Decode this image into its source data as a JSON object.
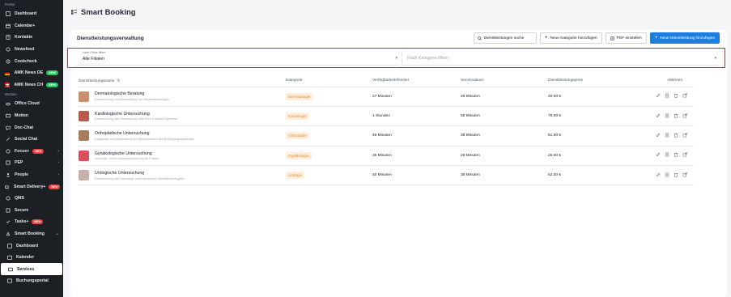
{
  "sidebar": {
    "section_portal": "Portal",
    "section_module": "Module",
    "portal_items": [
      {
        "label": "Dashboard",
        "icon": "dashboard-icon"
      },
      {
        "label": "Calendar+",
        "icon": "calendar-icon"
      },
      {
        "label": "Kontakte",
        "icon": "contacts-icon"
      },
      {
        "label": "Newsfeed",
        "icon": "newsfeed-icon"
      },
      {
        "label": "Cookcheck",
        "icon": "cookcheck-icon"
      },
      {
        "label": "AMK News DE",
        "icon": "flag-de-icon",
        "badge": "NEW"
      },
      {
        "label": "AMK News CH",
        "icon": "flag-ch-icon",
        "badge": "NEW"
      }
    ],
    "module_items": [
      {
        "label": "Office Cloud",
        "icon": "cloud-icon"
      },
      {
        "label": "Motion",
        "icon": "motion-icon"
      },
      {
        "label": "Doc-Chat",
        "icon": "chat-icon"
      },
      {
        "label": "Social Chat",
        "icon": "social-chat-icon"
      },
      {
        "label": "Focus+",
        "icon": "focus-icon",
        "badge": "NEU"
      },
      {
        "label": "PEP",
        "icon": "pep-icon"
      },
      {
        "label": "People",
        "icon": "people-icon"
      },
      {
        "label": "Smart Delivery+",
        "icon": "delivery-icon",
        "badge": "NEU"
      },
      {
        "label": "QMS",
        "icon": "qms-icon"
      },
      {
        "label": "Secure",
        "icon": "secure-icon"
      },
      {
        "label": "Tasks+",
        "icon": "tasks-icon",
        "badge": "NEU"
      },
      {
        "label": "Smart Booking",
        "icon": "booking-icon"
      }
    ],
    "sub_items": [
      {
        "label": "Dashboard",
        "icon": "dashboard-icon"
      },
      {
        "label": "Kalender",
        "icon": "calendar-icon"
      },
      {
        "label": "Services",
        "icon": "services-icon"
      },
      {
        "label": "Buchungsportal",
        "icon": "portal-icon"
      }
    ]
  },
  "header": {
    "title": "Smart Booking"
  },
  "card": {
    "title": "Dienstleistungsverwaltung",
    "search_placeholder": "Dienstleistungen suche",
    "add_category": "Neue Kategorie hinzufügen",
    "pdf": "PDF einstellen",
    "add_service": "Neue Dienstleistung hinzufügen"
  },
  "filters": {
    "branch_label": "Nach Filiale filtern",
    "branch_value": "Alle Filialen",
    "category_placeholder": "Nach Kategorie filtern"
  },
  "table": {
    "headers": [
      "Dienstleistungsname",
      "Kategorie",
      "Verfügbarkeitsfenster",
      "Servicedauer",
      "Dienstleistungspreis",
      "Aktionen"
    ],
    "rows": [
      {
        "name": "Dermatologische Beratung",
        "desc": "Untersuchung und Behandlung von Hauterkrankungen",
        "category": "Dermatologie",
        "window": "27 Minuten",
        "duration": "25 Minuten",
        "price": "20,00 €",
        "thumb": "#c98e6f"
      },
      {
        "name": "Kardiologische Untersuchung",
        "desc": "Untersuchung des Herzens und des Herz-Kreislauf-Systems",
        "category": "Kardiologie",
        "window": "1 Stunden",
        "duration": "55 Minuten",
        "price": "75,00 €",
        "thumb": "#b85a4a"
      },
      {
        "name": "Orthopädische Untersuchung",
        "desc": "Diagnostik und Behandlung von Beschwerden des Bewegungsapparates",
        "category": "Orthopädie",
        "window": "45 Minuten",
        "duration": "38 Minuten",
        "price": "61,90 €",
        "thumb": "#a77b5c"
      },
      {
        "name": "Gynäkologische Untersuchung",
        "desc": "Vorsorge- und Kontrolluntersuchung für Frauen",
        "category": "Gynäkologie",
        "window": "25 Minuten",
        "duration": "25 Minuten",
        "price": "25,00 €",
        "thumb": "#d94f5c"
      },
      {
        "name": "Urologische Untersuchung",
        "desc": "Untersuchung der Harnwege und männlichen Geschlechtsorgane",
        "category": "Urologie",
        "window": "40 Minuten",
        "duration": "35 Minuten",
        "price": "52,00 €",
        "thumb": "#c9b0a6"
      }
    ]
  }
}
